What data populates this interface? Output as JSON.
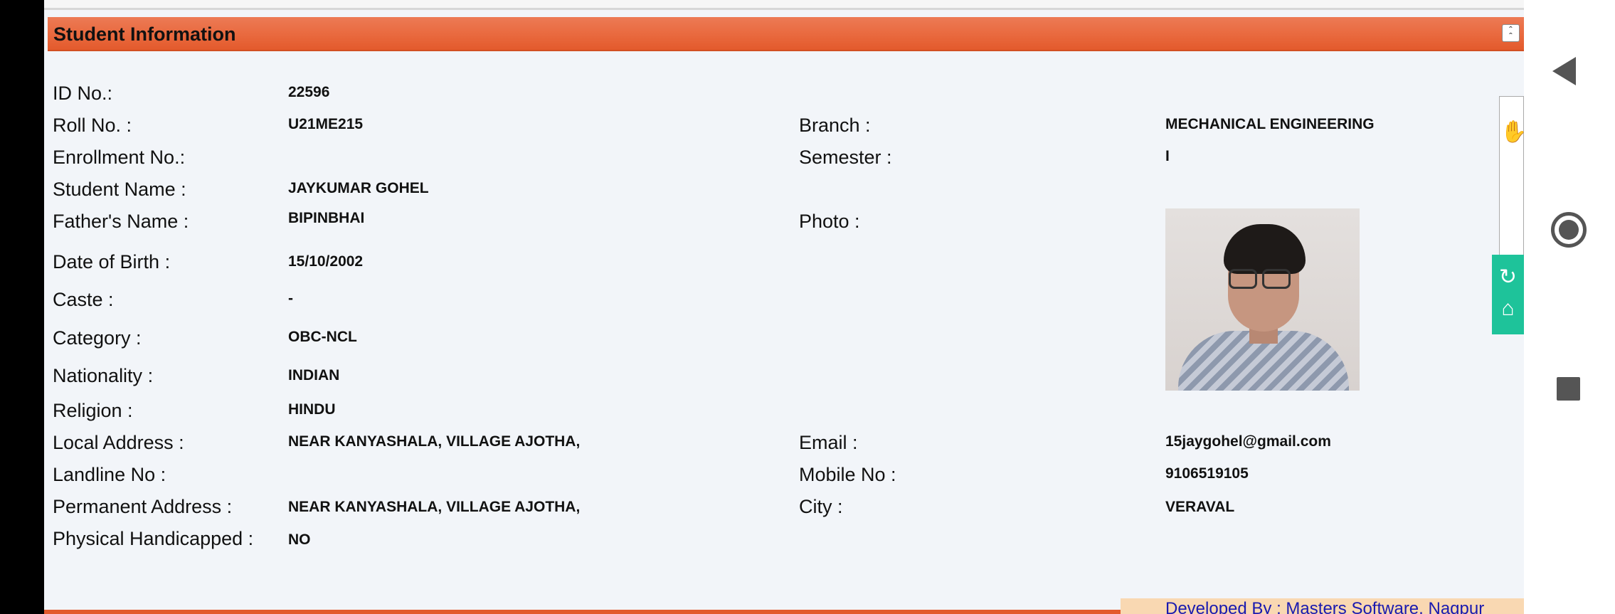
{
  "panel": {
    "title": "Student Information",
    "collapse_glyph": "˄˄"
  },
  "fields": {
    "id_no": {
      "label": "ID No.:",
      "value": "22596"
    },
    "roll_no": {
      "label": "Roll No. :",
      "value": "U21ME215"
    },
    "branch": {
      "label": "Branch :",
      "value": "MECHANICAL ENGINEERING"
    },
    "enrollment_no": {
      "label": "Enrollment No.:",
      "value": ""
    },
    "semester": {
      "label": "Semester :",
      "value": "I"
    },
    "student_name": {
      "label": "Student Name :",
      "value": "JAYKUMAR GOHEL"
    },
    "father_name": {
      "label": "Father's Name :",
      "value": "BIPINBHAI"
    },
    "photo": {
      "label": "Photo :"
    },
    "dob": {
      "label": "Date of Birth :",
      "value": "15/10/2002"
    },
    "caste": {
      "label": "Caste :",
      "value": "-"
    },
    "category": {
      "label": "Category :",
      "value": "OBC-NCL"
    },
    "nationality": {
      "label": "Nationality :",
      "value": "INDIAN"
    },
    "religion": {
      "label": "Religion :",
      "value": "HINDU"
    },
    "local_address": {
      "label": "Local Address :",
      "value": "NEAR KANYASHALA, VILLAGE AJOTHA,"
    },
    "email": {
      "label": "Email :",
      "value": "15jaygohel@gmail.com"
    },
    "landline": {
      "label": "Landline No :",
      "value": ""
    },
    "mobile": {
      "label": "Mobile No :",
      "value": "9106519105"
    },
    "permanent_address": {
      "label": "Permanent Address :",
      "value": "NEAR KANYASHALA, VILLAGE AJOTHA,"
    },
    "city": {
      "label": "City :",
      "value": "VERAVAL"
    },
    "physical_handicapped": {
      "label": "Physical Handicapped :",
      "value": "NO"
    }
  },
  "footer": {
    "developed_by": "Developed By : Masters Software, Nagpur"
  },
  "side_widget": {
    "icon_top": "hand-icon",
    "icon_mid": "refresh-icon",
    "icon_bottom": "basket-icon"
  },
  "colors": {
    "header_orange": "#e9693e",
    "page_bg": "#f2f5f9",
    "footer_link": "#1a1ab0",
    "side_widget_teal": "#1ec39a"
  }
}
